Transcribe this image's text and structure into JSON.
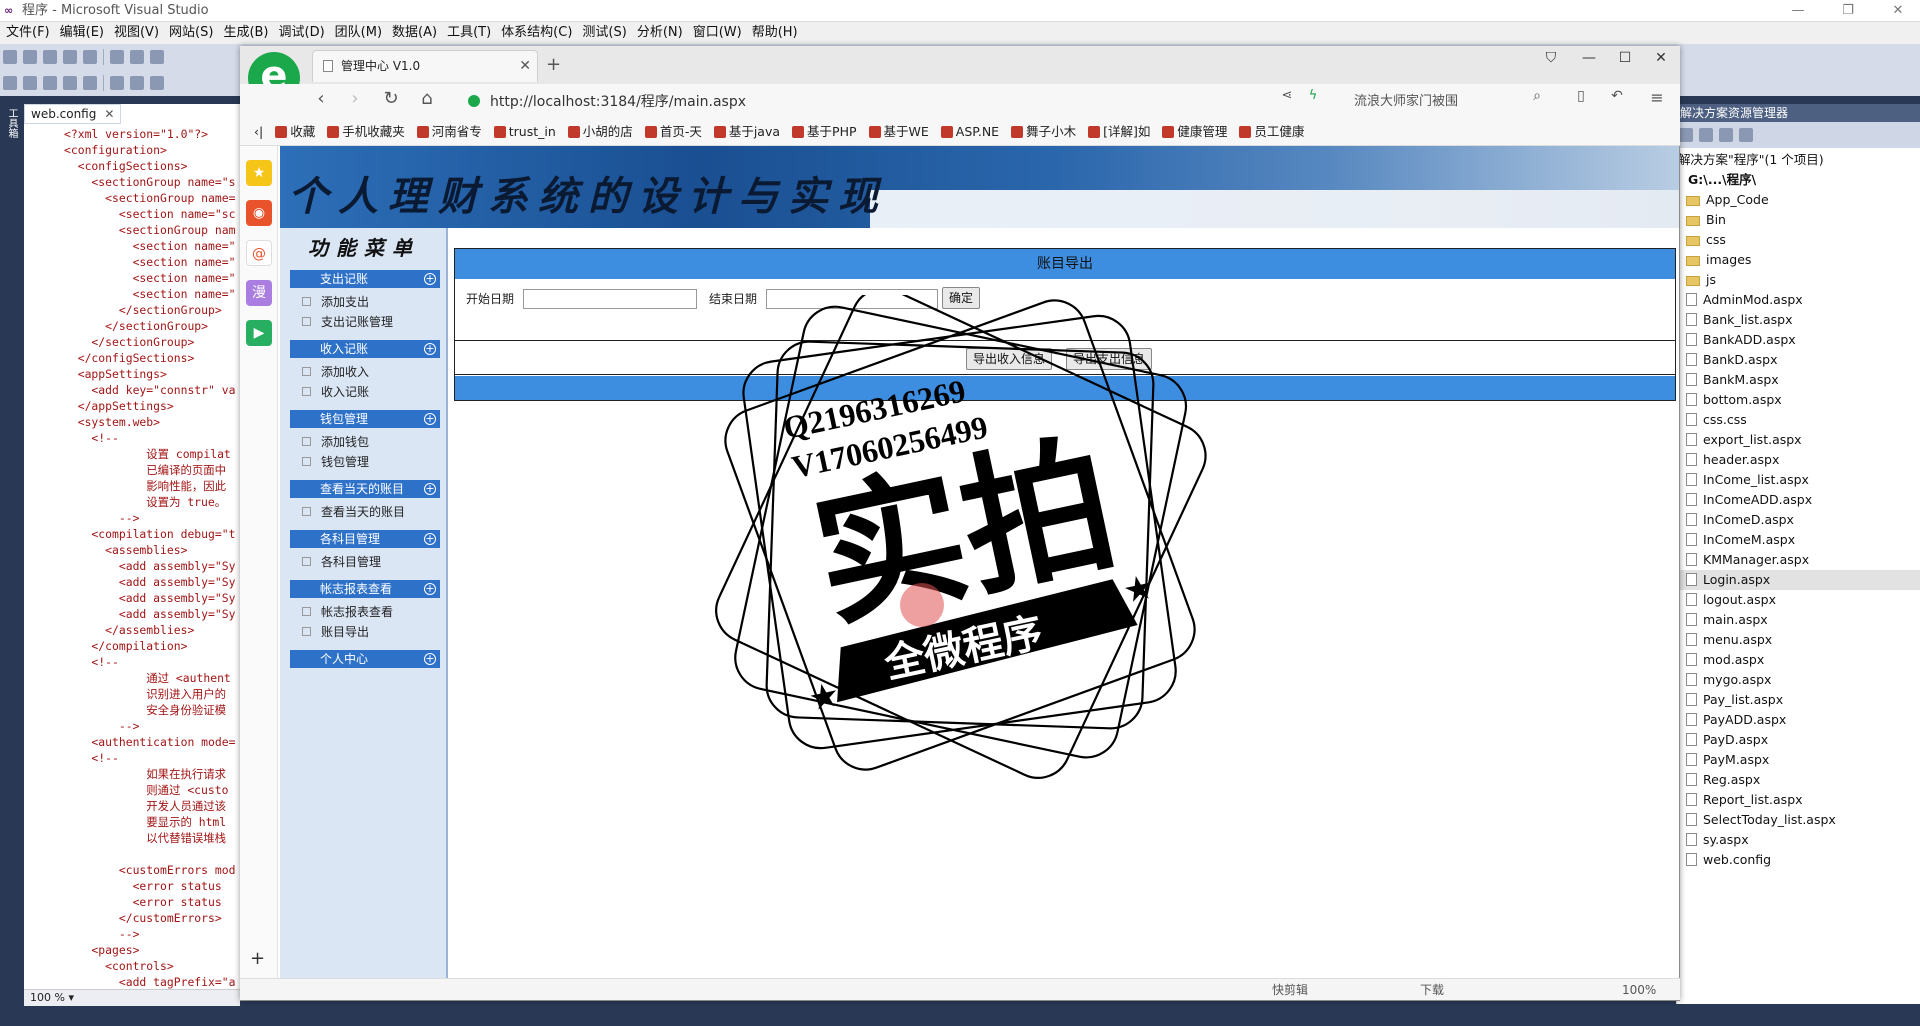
{
  "vs": {
    "title": "程序 - Microsoft Visual Studio",
    "menu": [
      "文件(F)",
      "编辑(E)",
      "视图(V)",
      "网站(S)",
      "生成(B)",
      "调试(D)",
      "团队(M)",
      "数据(A)",
      "工具(T)",
      "体系结构(C)",
      "测试(S)",
      "分析(N)",
      "窗口(W)",
      "帮助(H)"
    ],
    "toolbox_label": "工具箱",
    "editor_tab": "web.config",
    "zoom": "100 %",
    "code_lines": [
      "<?xml version=\"1.0\"?>",
      "<configuration>",
      "  <configSections>",
      "    <sectionGroup name=\"s",
      "      <sectionGroup name=",
      "        <section name=\"sc",
      "        <sectionGroup nam",
      "          <section name=\"",
      "          <section name=\"",
      "          <section name=\"",
      "          <section name=\"",
      "        </sectionGroup>",
      "      </sectionGroup>",
      "    </sectionGroup>",
      "  </configSections>",
      "  <appSettings>",
      "    <add key=\"connstr\" va",
      "  </appSettings>",
      "  <system.web>",
      "    <!--",
      "            设置 compilat",
      "            已编译的页面中",
      "            影响性能，因此",
      "            设置为 true。",
      "        -->",
      "    <compilation debug=\"t",
      "      <assemblies>",
      "        <add assembly=\"Sy",
      "        <add assembly=\"Sy",
      "        <add assembly=\"Sy",
      "        <add assembly=\"Sy",
      "      </assemblies>",
      "    </compilation>",
      "    <!--",
      "            通过 <authent",
      "            识别进入用户的",
      "            安全身份验证模",
      "        -->",
      "    <authentication mode=",
      "    <!--",
      "            如果在执行请求",
      "            则通过 <custo",
      "            开发人员通过该",
      "            要显示的 html",
      "            以代替错误堆栈",
      "",
      "        <customErrors mod",
      "          <error status",
      "          <error status",
      "        </customErrors>",
      "        -->",
      "    <pages>",
      "      <controls>",
      "        <add tagPrefix=\"a"
    ],
    "solution_explorer": {
      "title": "解决方案资源管理器",
      "solution_label": "解决方案\"程序\"(1 个项目)",
      "project": "G:\\...\\程序\\",
      "folders": [
        "App_Code",
        "Bin",
        "css",
        "images",
        "js"
      ],
      "files": [
        "AdminMod.aspx",
        "Bank_list.aspx",
        "BankADD.aspx",
        "BankD.aspx",
        "BankM.aspx",
        "bottom.aspx",
        "css.css",
        "export_list.aspx",
        "header.aspx",
        "InCome_list.aspx",
        "InComeADD.aspx",
        "InComeD.aspx",
        "InComeM.aspx",
        "KMManager.aspx",
        "Login.aspx",
        "logout.aspx",
        "main.aspx",
        "menu.aspx",
        "mod.aspx",
        "mygo.aspx",
        "Pay_list.aspx",
        "PayADD.aspx",
        "PayD.aspx",
        "PayM.aspx",
        "Reg.aspx",
        "Report_list.aspx",
        "SelectToday_list.aspx",
        "sy.aspx",
        "web.config"
      ],
      "selected": "Login.aspx"
    }
  },
  "browser": {
    "tab_title": "管理中心 V1.0",
    "url": "http://localhost:3184/程序/main.aspx",
    "search_text": "流浪大师家门被围",
    "favorites": [
      "收藏",
      "手机收藏夹",
      "河南省专",
      "trust_in",
      "小胡的店",
      "首页-天",
      "基于java",
      "基于PHP",
      "基于WE",
      "ASP.NE",
      "舞子小木",
      "[详解]如",
      "健康管理",
      "员工健康"
    ],
    "status_items": [
      "快剪辑",
      "下载",
      "100%"
    ]
  },
  "page": {
    "banner_title": "个人理财系统的设计与实现",
    "menu_title": "功能菜单",
    "menu": [
      {
        "group": "支出记账",
        "items": [
          "添加支出",
          "支出记账管理"
        ]
      },
      {
        "group": "收入记账",
        "items": [
          "添加收入",
          "收入记账"
        ]
      },
      {
        "group": "钱包管理",
        "items": [
          "添加钱包",
          "钱包管理"
        ]
      },
      {
        "group": "查看当天的账目",
        "items": [
          "查看当天的账目"
        ]
      },
      {
        "group": "各科目管理",
        "items": [
          "各科目管理"
        ]
      },
      {
        "group": "帐志报表查看",
        "items": [
          "帐志报表查看",
          "账目导出"
        ]
      },
      {
        "group": "个人中心",
        "items": []
      }
    ],
    "panel_title": "账目导出",
    "start_label": "开始日期",
    "end_label": "结束日期",
    "confirm_btn": "确定",
    "export_income_btn": "导出收入信息",
    "export_pay_btn": "导出支出信息"
  },
  "watermark": {
    "qq": "Q2196316269",
    "v": "V17060256499",
    "big": "实拍",
    "ribbon": "全微程序"
  }
}
